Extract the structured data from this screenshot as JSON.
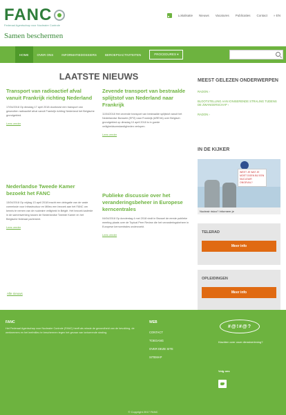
{
  "header": {
    "logo": "FANC",
    "logo_sub": "Federaal Agentschap voor Nucleaire Controle",
    "tagline": "Samen beschermen",
    "links": [
      "Lokalisatie",
      "Nieuws",
      "Vacatures",
      "Publicaties",
      "Contact",
      "» EN"
    ]
  },
  "nav": {
    "items": [
      "Home",
      "Over ons",
      "Informatiedossiers",
      "Beroepsactiviteiten"
    ],
    "procedures": "Procedures ▾",
    "search_placeholder": ""
  },
  "main": {
    "title": "LAATSTE NIEUWS",
    "articles": [
      {
        "title": "Transport van radioactief afval vanuit Frankrijk richting Nederland",
        "body": "17/04/2018     Op dinsdag 17 april 2018 doorkruist een transport van gesmolten radioactief afval vanuit Frankrijk richting Nederland het Belgische grondgebied.",
        "more": "Lees verder"
      },
      {
        "title": "Zevende transport van bestraalde splijtstof van Nederland naar Frankrijk",
        "body": "11/04/2018     Het zevende transport van bestraalde splijtstof vanuit het Nederlandse Borssele (EPZ) naar Frankrijk (AREVA) over Belgisch grondgebied op dinsdag 10 april 2018 is in goede veiligheidsomstandigheden verlopen.",
        "more": "Lees verder"
      },
      {
        "title": "Nederlandse Tweede Kamer bezoekt het FANC",
        "body": "13/04/2018     Op vrijdag 13 april 2018 bracht een delegatie van de vaste commissie voor Infrastructuur en Milieu een bezoek aan het FANC om kennis te nemen van de nucleaire veiligheid in België. Het bezoek kaderde in de samenwerking tussen de Nederlandse Tweede Kamer en het Belgische federaal parlement.",
        "more": "Lees verder"
      },
      {
        "title": "Publieke discussie over het veranderingsbeheer in Europese kerncentrales",
        "body": "04/04/2018     Op donderdag 4 mei 2018 vindt in Brussel de eerste publieke meeting plaats over de Topical Peer Review die het veranderingsbeheer in Europese kerncentrales onderzoekt.",
        "more": "Lees verder"
      }
    ],
    "archive": "Alle nieuws"
  },
  "sidebar": {
    "popular_title": "MEEST GELEZEN ONDERWERPEN",
    "popular_links": [
      "RADON",
      "BLOOTSTELLING AAN IONISERENDE STRALING TIJDENS DE ZWANGERSCHAP",
      "RADON"
    ],
    "video_title": "IN DE KIJKER",
    "video_card": "WEET JE WAT JE MOET DOEN BIJ EEN NUCLEAIR ONGEVAL?",
    "video_caption": "Nucleair risico? Informeer je",
    "telerad_title": "TELERAD",
    "telerad_button": "Meer info",
    "training_title": "OPLEIDINGEN",
    "training_button": "Meer info"
  },
  "footer": {
    "about_title": "FANC",
    "about_text": "Het Federaal Agentschap voor Nucleaire Controle (FANC) heeft als missie de gezondheid van de bevolking, de werknemers en het leefmilieu te beschermen tegen het gevaar van ioniserende straling.",
    "links_title": "WEB",
    "links": [
      "CONTACT",
      "TOEGANG",
      "OVER DEZE SITE",
      "SITEMAP"
    ],
    "talk_logo": "#@!#@?",
    "complaint": "Klachten over onze dienstverlening?",
    "follow": "Volg ons",
    "copyright": "© Copyright 2017 FANC"
  }
}
